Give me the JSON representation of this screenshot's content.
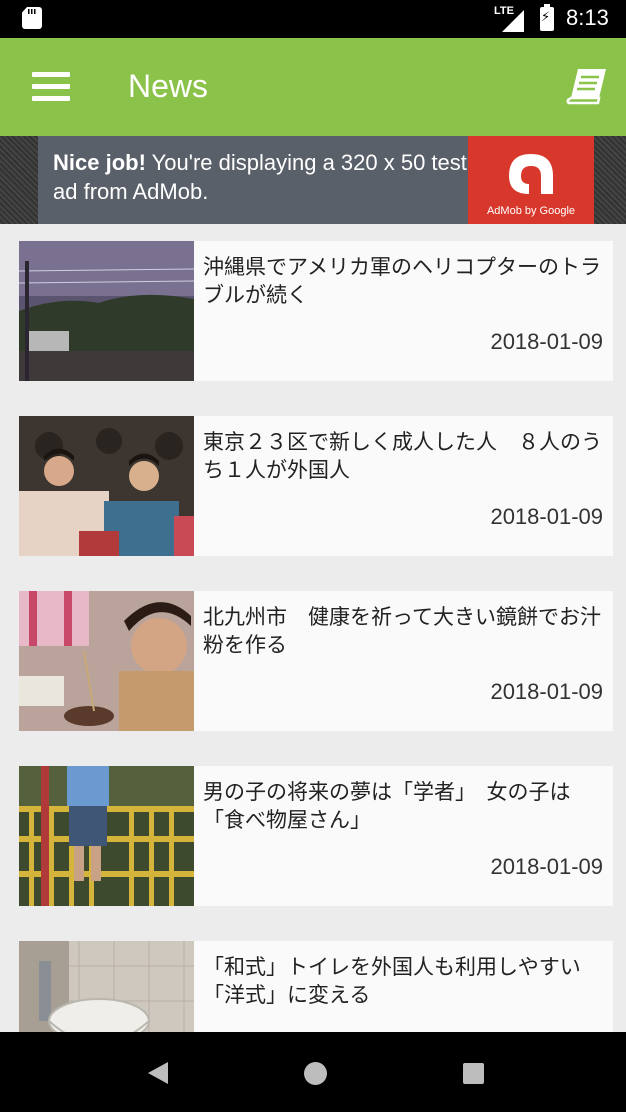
{
  "status_bar": {
    "network": "LTE",
    "time": "8:13"
  },
  "app_bar": {
    "title": "News",
    "menu_icon": "hamburger-menu-icon",
    "action_icon": "book-icon",
    "color": "#8bc34a"
  },
  "ad": {
    "bold_text": "Nice job!",
    "text": " You're displaying a 320 x 50 test ad from AdMob.",
    "logo_text": "AdMob by Google"
  },
  "news": [
    {
      "headline": "沖縄県でアメリカ軍のヘリコプターのトラブルが続く",
      "date": "2018-01-09",
      "thumbnail": "helicopter-fence"
    },
    {
      "headline": "東京２３区で新しく成人した人　８人のうち１人が外国人",
      "date": "2018-01-09",
      "thumbnail": "coming-of-age-kimono"
    },
    {
      "headline": "北九州市　健康を祈って大きい鏡餅でお汁粉を作る",
      "date": "2018-01-09",
      "thumbnail": "child-eating"
    },
    {
      "headline": "男の子の将来の夢は「学者」　女の子は「食べ物屋さん」",
      "date": "2018-01-09",
      "thumbnail": "child-climbing"
    },
    {
      "headline": "「和式」トイレを外国人も利用しやすい「洋式」に変える",
      "date": "",
      "thumbnail": "japanese-toilet"
    }
  ],
  "nav_bar": {
    "back_icon": "back-icon",
    "home_icon": "home-icon",
    "recents_icon": "recents-icon"
  }
}
